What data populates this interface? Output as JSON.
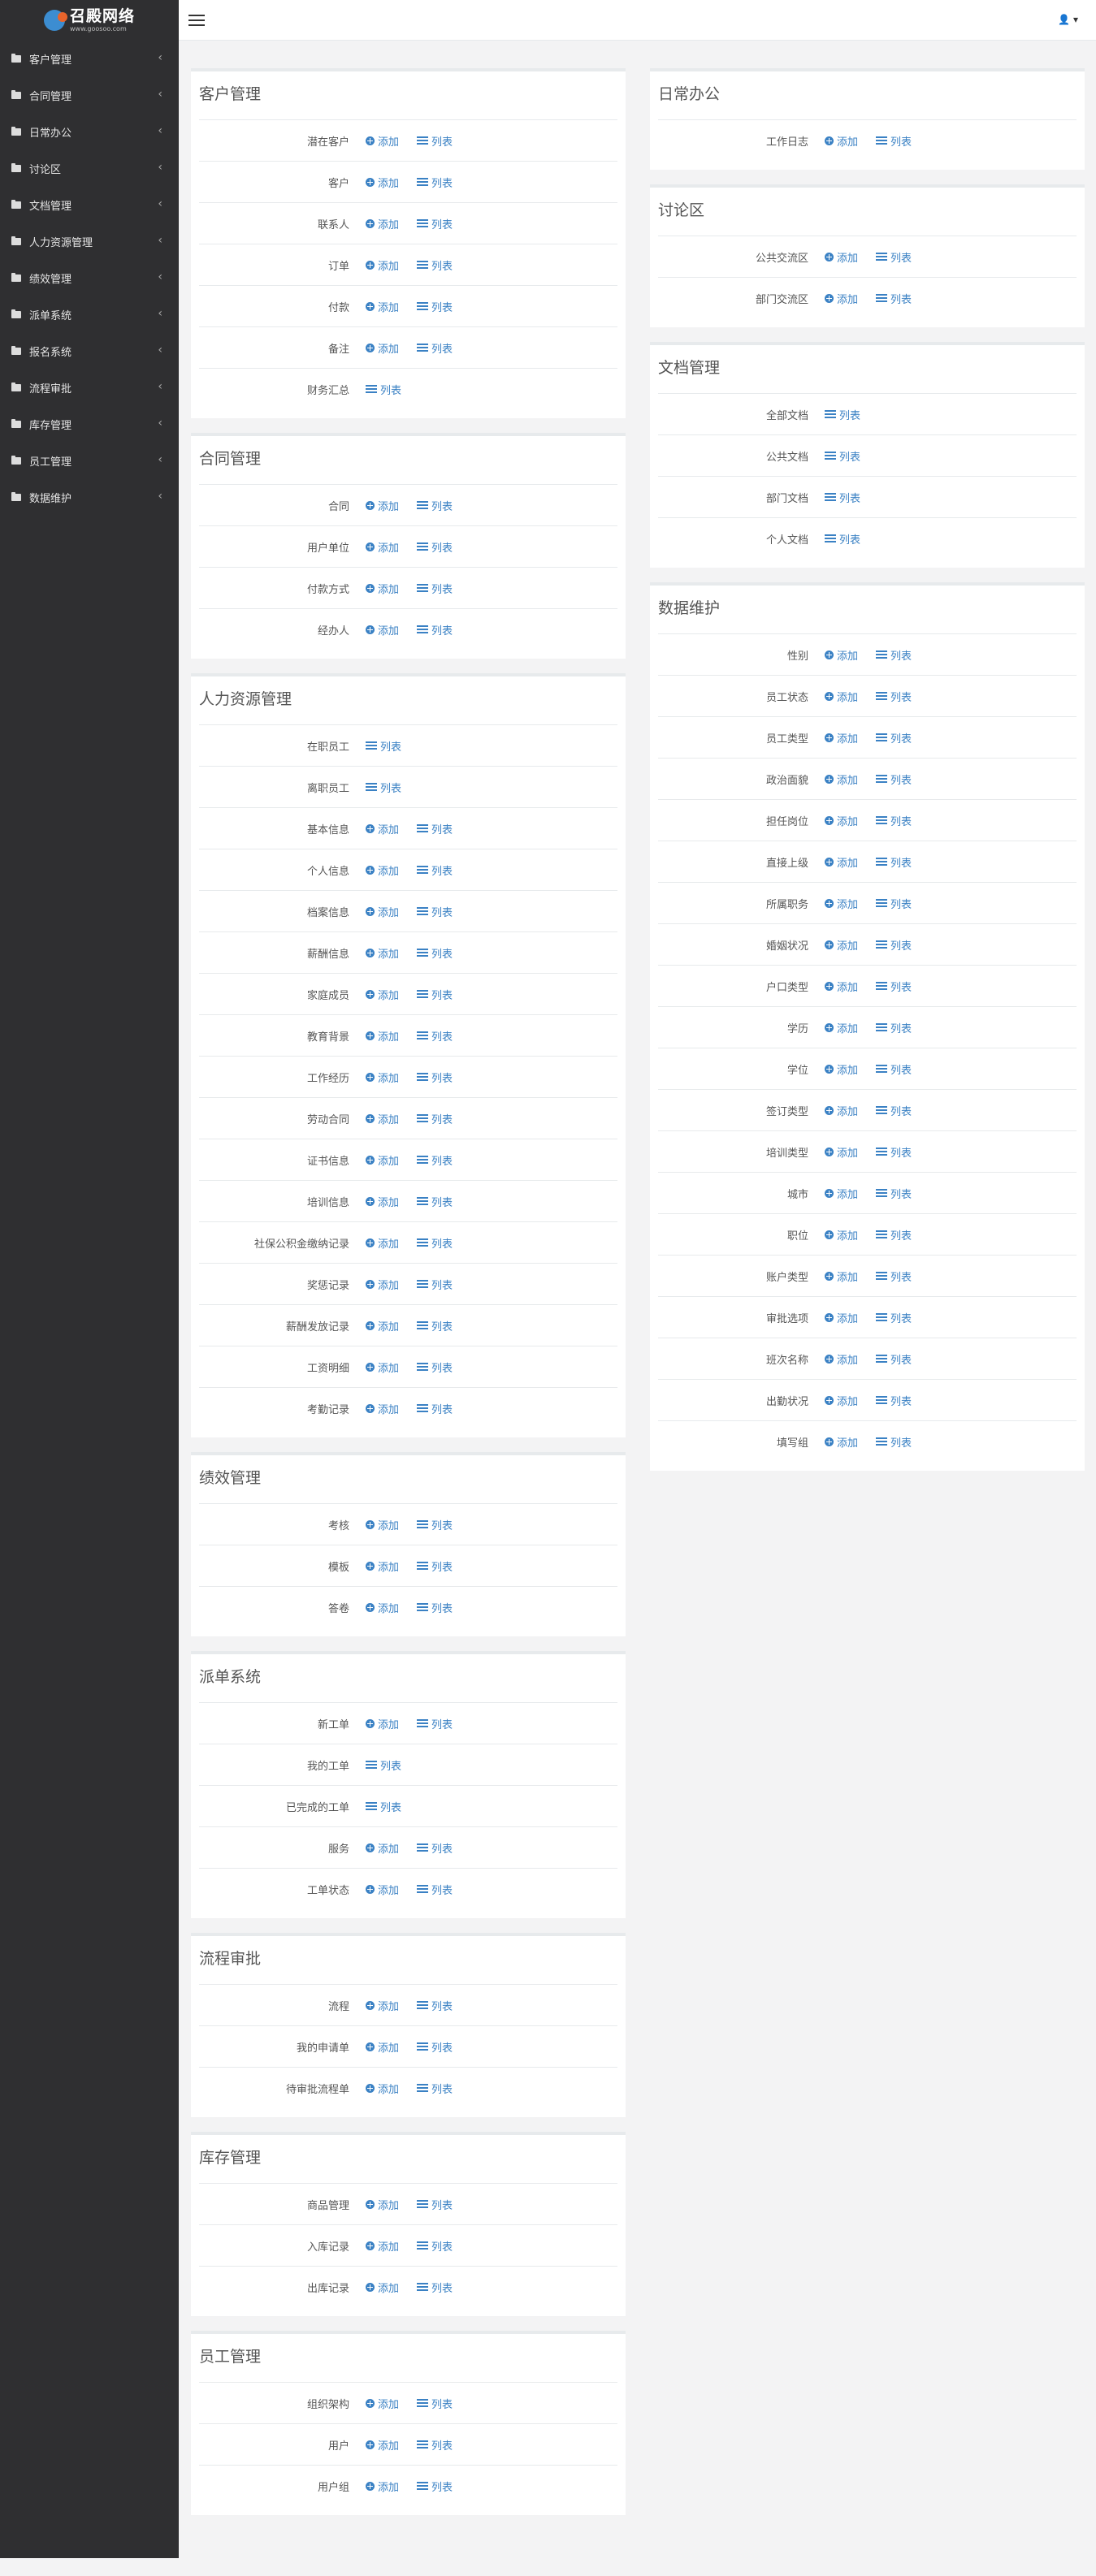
{
  "brand": {
    "name": "召殿网络",
    "sub": "www.goosoo.com"
  },
  "topbar": {
    "user_icon": "user-icon"
  },
  "sidebar": {
    "items": [
      {
        "label": "客户管理"
      },
      {
        "label": "合同管理"
      },
      {
        "label": "日常办公"
      },
      {
        "label": "讨论区"
      },
      {
        "label": "文档管理"
      },
      {
        "label": "人力资源管理"
      },
      {
        "label": "绩效管理"
      },
      {
        "label": "派单系统"
      },
      {
        "label": "报名系统"
      },
      {
        "label": "流程审批"
      },
      {
        "label": "库存管理"
      },
      {
        "label": "员工管理"
      },
      {
        "label": "数据维护"
      }
    ]
  },
  "actions": {
    "add": "添加",
    "list": "列表"
  },
  "left_panels": [
    {
      "title": "客户管理",
      "rows": [
        {
          "label": "潜在客户",
          "add": true,
          "list": true
        },
        {
          "label": "客户",
          "add": true,
          "list": true
        },
        {
          "label": "联系人",
          "add": true,
          "list": true
        },
        {
          "label": "订单",
          "add": true,
          "list": true
        },
        {
          "label": "付款",
          "add": true,
          "list": true
        },
        {
          "label": "备注",
          "add": true,
          "list": true
        },
        {
          "label": "财务汇总",
          "add": false,
          "list": true
        }
      ]
    },
    {
      "title": "合同管理",
      "rows": [
        {
          "label": "合同",
          "add": true,
          "list": true
        },
        {
          "label": "用户单位",
          "add": true,
          "list": true
        },
        {
          "label": "付款方式",
          "add": true,
          "list": true
        },
        {
          "label": "经办人",
          "add": true,
          "list": true
        }
      ]
    },
    {
      "title": "人力资源管理",
      "rows": [
        {
          "label": "在职员工",
          "add": false,
          "list": true
        },
        {
          "label": "离职员工",
          "add": false,
          "list": true
        },
        {
          "label": "基本信息",
          "add": true,
          "list": true
        },
        {
          "label": "个人信息",
          "add": true,
          "list": true
        },
        {
          "label": "档案信息",
          "add": true,
          "list": true
        },
        {
          "label": "薪酬信息",
          "add": true,
          "list": true
        },
        {
          "label": "家庭成员",
          "add": true,
          "list": true
        },
        {
          "label": "教育背景",
          "add": true,
          "list": true
        },
        {
          "label": "工作经历",
          "add": true,
          "list": true
        },
        {
          "label": "劳动合同",
          "add": true,
          "list": true
        },
        {
          "label": "证书信息",
          "add": true,
          "list": true
        },
        {
          "label": "培训信息",
          "add": true,
          "list": true
        },
        {
          "label": "社保公积金缴纳记录",
          "add": true,
          "list": true
        },
        {
          "label": "奖惩记录",
          "add": true,
          "list": true
        },
        {
          "label": "薪酬发放记录",
          "add": true,
          "list": true
        },
        {
          "label": "工资明细",
          "add": true,
          "list": true
        },
        {
          "label": "考勤记录",
          "add": true,
          "list": true
        }
      ]
    },
    {
      "title": "绩效管理",
      "rows": [
        {
          "label": "考核",
          "add": true,
          "list": true
        },
        {
          "label": "模板",
          "add": true,
          "list": true
        },
        {
          "label": "答卷",
          "add": true,
          "list": true
        }
      ]
    },
    {
      "title": "派单系统",
      "rows": [
        {
          "label": "新工单",
          "add": true,
          "list": true
        },
        {
          "label": "我的工单",
          "add": false,
          "list": true
        },
        {
          "label": "已完成的工单",
          "add": false,
          "list": true
        },
        {
          "label": "服务",
          "add": true,
          "list": true
        },
        {
          "label": "工单状态",
          "add": true,
          "list": true
        }
      ]
    },
    {
      "title": "流程审批",
      "rows": [
        {
          "label": "流程",
          "add": true,
          "list": true
        },
        {
          "label": "我的申请单",
          "add": true,
          "list": true
        },
        {
          "label": "待审批流程单",
          "add": true,
          "list": true
        }
      ]
    },
    {
      "title": "库存管理",
      "rows": [
        {
          "label": "商品管理",
          "add": true,
          "list": true
        },
        {
          "label": "入库记录",
          "add": true,
          "list": true
        },
        {
          "label": "出库记录",
          "add": true,
          "list": true
        }
      ]
    },
    {
      "title": "员工管理",
      "rows": [
        {
          "label": "组织架构",
          "add": true,
          "list": true
        },
        {
          "label": "用户",
          "add": true,
          "list": true
        },
        {
          "label": "用户组",
          "add": true,
          "list": true
        }
      ]
    }
  ],
  "right_panels": [
    {
      "title": "日常办公",
      "rows": [
        {
          "label": "工作日志",
          "add": true,
          "list": true
        }
      ]
    },
    {
      "title": "讨论区",
      "rows": [
        {
          "label": "公共交流区",
          "add": true,
          "list": true
        },
        {
          "label": "部门交流区",
          "add": true,
          "list": true
        }
      ]
    },
    {
      "title": "文档管理",
      "rows": [
        {
          "label": "全部文档",
          "add": false,
          "list": true
        },
        {
          "label": "公共文档",
          "add": false,
          "list": true
        },
        {
          "label": "部门文档",
          "add": false,
          "list": true
        },
        {
          "label": "个人文档",
          "add": false,
          "list": true
        }
      ]
    },
    {
      "title": "数据维护",
      "rows": [
        {
          "label": "性别",
          "add": true,
          "list": true
        },
        {
          "label": "员工状态",
          "add": true,
          "list": true
        },
        {
          "label": "员工类型",
          "add": true,
          "list": true
        },
        {
          "label": "政治面貌",
          "add": true,
          "list": true
        },
        {
          "label": "担任岗位",
          "add": true,
          "list": true
        },
        {
          "label": "直接上级",
          "add": true,
          "list": true
        },
        {
          "label": "所属职务",
          "add": true,
          "list": true
        },
        {
          "label": "婚姻状况",
          "add": true,
          "list": true
        },
        {
          "label": "户口类型",
          "add": true,
          "list": true
        },
        {
          "label": "学历",
          "add": true,
          "list": true
        },
        {
          "label": "学位",
          "add": true,
          "list": true
        },
        {
          "label": "签订类型",
          "add": true,
          "list": true
        },
        {
          "label": "培训类型",
          "add": true,
          "list": true
        },
        {
          "label": "城市",
          "add": true,
          "list": true
        },
        {
          "label": "职位",
          "add": true,
          "list": true
        },
        {
          "label": "账户类型",
          "add": true,
          "list": true
        },
        {
          "label": "审批选项",
          "add": true,
          "list": true
        },
        {
          "label": "班次名称",
          "add": true,
          "list": true
        },
        {
          "label": "出勤状况",
          "add": true,
          "list": true
        },
        {
          "label": "填写组",
          "add": true,
          "list": true
        }
      ]
    }
  ]
}
